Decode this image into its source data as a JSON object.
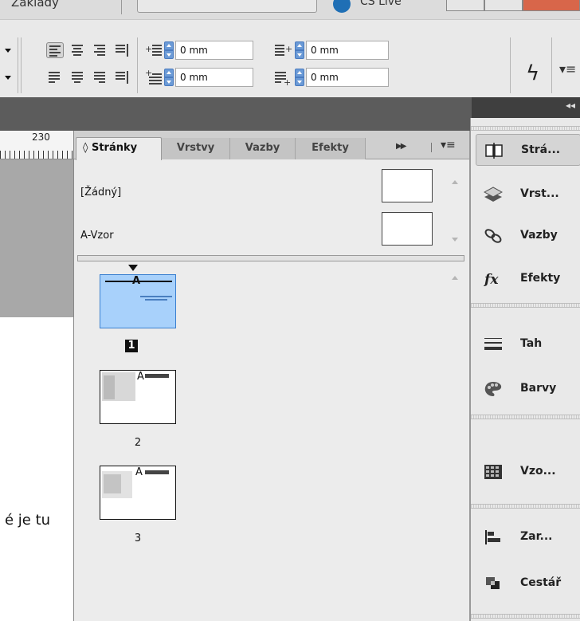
{
  "top_strip": {
    "workspace_label": "Základy",
    "cslive_label": "CS Live"
  },
  "control_bar": {
    "left_indent": "0 mm",
    "right_indent": "0 mm",
    "first_line_indent": "0 mm",
    "last_line_indent": "0 mm"
  },
  "ruler": {
    "mark": "230"
  },
  "document": {
    "text": "é je tu"
  },
  "pages_panel": {
    "tabs": [
      {
        "label": "◊ Stránky"
      },
      {
        "label": "Vrstvy"
      },
      {
        "label": "Vazby"
      },
      {
        "label": "Efekty"
      }
    ],
    "masters": [
      {
        "label": "[Žádný]"
      },
      {
        "label": "A-Vzor"
      }
    ],
    "pages": [
      {
        "number": "1",
        "master_letter": "A"
      },
      {
        "number": "2",
        "master_letter": "A"
      },
      {
        "number": "3",
        "master_letter": "A"
      }
    ]
  },
  "dock": {
    "items": [
      {
        "label": "Strá...",
        "icon": "pages-icon"
      },
      {
        "label": "Vrst...",
        "icon": "layers-icon"
      },
      {
        "label": "Vazby",
        "icon": "links-icon"
      },
      {
        "label": "Efekty",
        "icon": "fx-icon"
      },
      {
        "label": "Tah",
        "icon": "stroke-icon"
      },
      {
        "label": "Barvy",
        "icon": "palette-icon"
      },
      {
        "label": "Vzo...",
        "icon": "swatches-icon"
      },
      {
        "label": "Zar...",
        "icon": "align-icon"
      },
      {
        "label": "Cestář",
        "icon": "pathfinder-icon"
      }
    ]
  }
}
